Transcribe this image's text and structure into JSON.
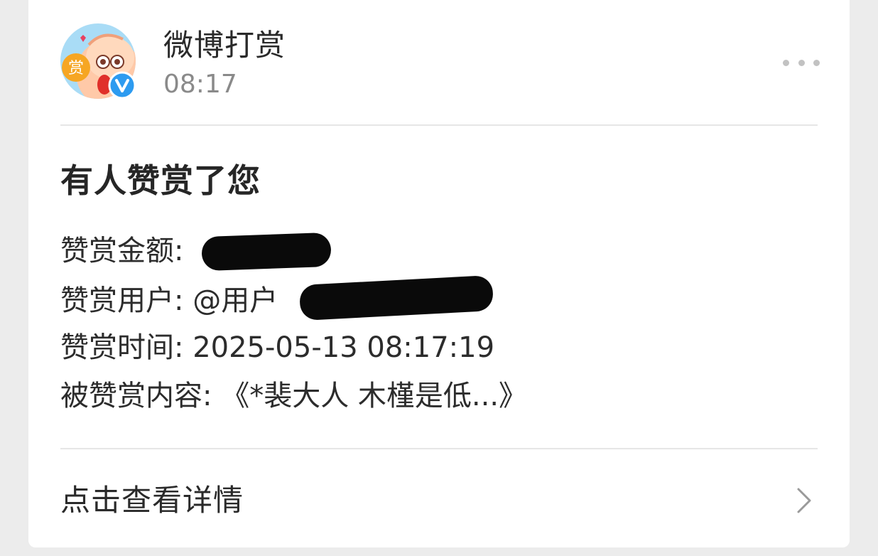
{
  "header": {
    "sender_name": "微博打赏",
    "time": "08:17",
    "avatar_badge_char": "赏",
    "avatar_icon": "reward-mascot-avatar",
    "verified_icon": "verified-v-icon",
    "more_icon": "more-dots-icon"
  },
  "notification": {
    "title": "有人赞赏了您",
    "lines": [
      {
        "label": "赞赏金额:",
        "value": ""
      },
      {
        "label": "赞赏用户:",
        "value": "@用户"
      },
      {
        "label": "赞赏时间:",
        "value": "2025-05-13 08:17:19"
      },
      {
        "label": "被赞赏内容:",
        "value": "《*裴大人 木槿是低...》"
      }
    ]
  },
  "footer": {
    "label": "点击查看详情",
    "chevron_icon": "chevron-right-icon"
  },
  "colors": {
    "background": "#ececec",
    "card": "#ffffff",
    "verified_blue": "#2d9bf0",
    "avatar_orange": "#f6a623"
  }
}
